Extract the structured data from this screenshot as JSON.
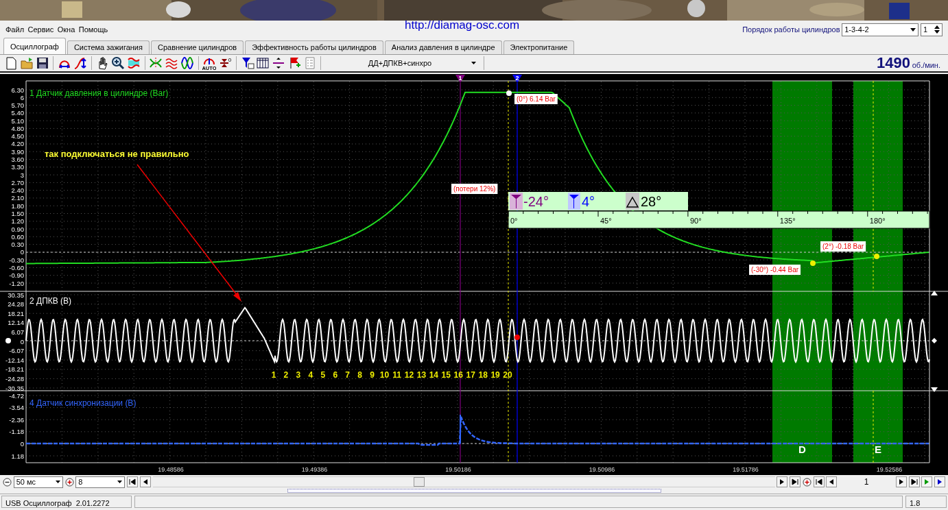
{
  "header": {
    "url": "http://diamag-osc.com"
  },
  "menu": [
    "Файл",
    "Сервис",
    "Окна",
    "Помощь"
  ],
  "cylinder_order": {
    "label": "Порядок работы цилиндров",
    "value": "1-3-4-2",
    "cylinder": "1"
  },
  "tabs": [
    {
      "label": "Осциллограф",
      "selected": true
    },
    {
      "label": "Система зажигания",
      "selected": false
    },
    {
      "label": "Сравнение цилиндров",
      "selected": false
    },
    {
      "label": "Эффективность работы цилиндров",
      "selected": false
    },
    {
      "label": "Анализ давления в цилиндре",
      "selected": false
    },
    {
      "label": "Электропитание",
      "selected": false
    }
  ],
  "toolbar": {
    "auto_caption": "AUTO",
    "zero_caption": "0",
    "mode": "ДД+ДПКВ+синхро",
    "rpm": "1490",
    "rpm_unit": "об./мин."
  },
  "plot": {
    "channels": [
      {
        "title": "1 Датчик давления в цилиндре (Bar)",
        "color": "#22dd22",
        "ticks": [
          "6.30",
          "6",
          "5.70",
          "5.40",
          "5.10",
          "4.80",
          "4.50",
          "4.20",
          "3.90",
          "3.60",
          "3.30",
          "3",
          "2.70",
          "2.40",
          "2.10",
          "1.80",
          "1.50",
          "1.20",
          "0.90",
          "0.60",
          "0.30",
          "0",
          "-0.30",
          "-0.60",
          "-0.90",
          "-1.20"
        ]
      },
      {
        "title": "2 ДПКВ (В)",
        "color": "#ffffff",
        "ticks": [
          "30.35",
          "24.28",
          "18.21",
          "12.14",
          "6.07",
          "0",
          "-6.07",
          "-12.14",
          "-18.21",
          "-24.28",
          "-30.35"
        ]
      },
      {
        "title": "4 Датчик синхронизации (В)",
        "color": "#3366ff",
        "ticks": [
          "-4.72",
          "-3.54",
          "-2.36",
          "-1.18",
          "0",
          "1.18"
        ]
      }
    ],
    "cursors": [
      {
        "label": "1",
        "color": "#800080"
      },
      {
        "label": "2",
        "color": "#0000ff"
      }
    ],
    "annotation": "так подключаться не правильно",
    "tooth_numbers": [
      "1",
      "2",
      "3",
      "4",
      "5",
      "6",
      "7",
      "8",
      "9",
      "10",
      "11",
      "12",
      "13",
      "14",
      "15",
      "16",
      "17",
      "18",
      "19",
      "20"
    ],
    "callouts": [
      "(0°) 6.14 Bar",
      "(потери 12%)",
      "(2°) -0.18 Bar",
      "(-30°) -0.44 Bar"
    ],
    "angles": {
      "cursor_1": "-24°",
      "cursor_2": "4°",
      "delta": "28°",
      "scale": [
        "0°",
        "45°",
        "90°",
        "135°",
        "180°"
      ]
    },
    "zones": [
      "D",
      "E"
    ],
    "time_ticks": [
      "19.48586",
      "19.49386",
      "19.50186",
      "19.50986",
      "19.51786",
      "19.52586"
    ]
  },
  "bottom": {
    "timebase": "50 мс",
    "channel_count": "8",
    "page": "1"
  },
  "status_bar": [
    "USB Осциллограф  2.01.2272",
    "1.8"
  ]
}
